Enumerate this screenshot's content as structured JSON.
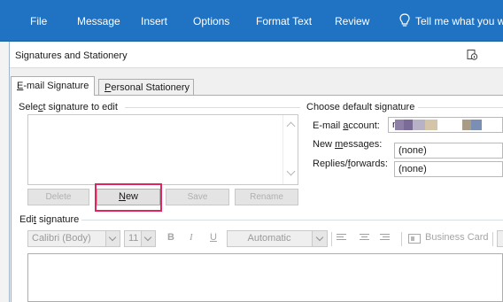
{
  "ribbon": {
    "tabs": [
      "File",
      "Message",
      "Insert",
      "Options",
      "Format Text",
      "Review"
    ],
    "tell_me": "Tell me what you want"
  },
  "dialog": {
    "title": "Signatures and Stationery",
    "tabs": [
      {
        "pre": "",
        "key": "E",
        "post": "-mail Signature"
      },
      {
        "pre": "",
        "key": "P",
        "post": "ersonal Stationery"
      }
    ],
    "select_label": {
      "pre": "Sele",
      "key": "c",
      "post": "t signature to edit"
    },
    "buttons": {
      "delete": "Delete",
      "new_key": "N",
      "new_rest": "ew",
      "save": "Save",
      "rename": "Rename"
    },
    "defaults": {
      "heading": "Choose default signature",
      "account_label": {
        "pre": "E-mail ",
        "key": "a",
        "post": "ccount:"
      },
      "account_value": "m",
      "new_messages_label": {
        "pre": "New ",
        "key": "m",
        "post": "essages:"
      },
      "new_messages_value": "(none)",
      "replies_label": {
        "pre": "Replies/",
        "key": "f",
        "post": "orwards:"
      },
      "replies_value": "(none)"
    },
    "edit": {
      "label": {
        "pre": "Edi",
        "key": "t",
        "post": " signature"
      },
      "font": "Calibri (Body)",
      "size": "11",
      "bold": "B",
      "italic": "I",
      "underline": "U",
      "color": "Automatic",
      "business_card": "Business Card"
    }
  },
  "icons": {
    "tell_me": "lightbulb-icon",
    "help": "help-icon",
    "business_card": "business-card-icon"
  },
  "colors": {
    "ribbon": "#1f73c2",
    "highlight": "#e0245e",
    "redacted": [
      "#8e7fa6",
      "#7a6b98",
      "#b8b2c6",
      "#d4c5a8",
      "#a99c86",
      "#7b8fb5"
    ]
  }
}
